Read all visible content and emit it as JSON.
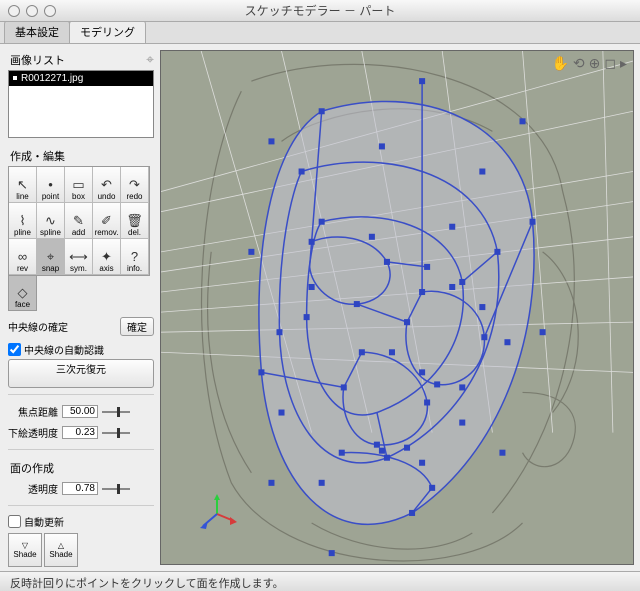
{
  "window": {
    "title": "スケッチモデラー － パート"
  },
  "tabs": {
    "items": [
      "基本設定",
      "モデリング"
    ],
    "active": 1
  },
  "image_list": {
    "label": "画像リスト",
    "items": [
      "R0012271.jpg"
    ]
  },
  "create_edit": {
    "label": "作成・編集"
  },
  "tools": [
    {
      "name": "line",
      "label": "line",
      "icon": "↖"
    },
    {
      "name": "point",
      "label": "point",
      "icon": "•"
    },
    {
      "name": "box",
      "label": "box",
      "icon": "▭"
    },
    {
      "name": "undo",
      "label": "undo",
      "icon": "↶"
    },
    {
      "name": "redo",
      "label": "redo",
      "icon": "↷"
    },
    {
      "name": "pline",
      "label": "pline",
      "icon": "⌇"
    },
    {
      "name": "spline",
      "label": "spline",
      "icon": "∿"
    },
    {
      "name": "add",
      "label": "add",
      "icon": "✎"
    },
    {
      "name": "remove",
      "label": "remov.",
      "icon": "✐"
    },
    {
      "name": "del",
      "label": "del.",
      "icon": "🗑"
    },
    {
      "name": "rev",
      "label": "rev",
      "icon": "∞"
    },
    {
      "name": "snap",
      "label": "snap",
      "icon": "⌖",
      "selected": true
    },
    {
      "name": "sym",
      "label": "sym.",
      "icon": "⟷"
    },
    {
      "name": "axis",
      "label": "axis",
      "icon": "✦"
    },
    {
      "name": "info",
      "label": "info.",
      "icon": "?"
    }
  ],
  "face_tool": {
    "label": "face",
    "icon": "◇"
  },
  "center": {
    "confirm_label": "中央線の確定",
    "confirm_btn": "確定",
    "auto_label": "中央線の自動認識",
    "auto_checked": true,
    "restore_btn": "三次元復元"
  },
  "params": {
    "focal_label": "焦点距離",
    "focal_value": "50.00",
    "opacity_label": "下絵透明度",
    "opacity_value": "0.23"
  },
  "face_creation": {
    "label": "面の作成",
    "trans_label": "透明度",
    "trans_value": "0.78"
  },
  "auto_update": {
    "label": "自動更新",
    "checked": false
  },
  "shade": {
    "down": "Shade",
    "up": "Shade"
  },
  "viewport_icons": [
    "hand-icon",
    "rotate-icon",
    "zoom-icon",
    "fit-icon",
    "chevron-icon"
  ],
  "status": "反時計回りにポイントをクリックして面を作成します。"
}
